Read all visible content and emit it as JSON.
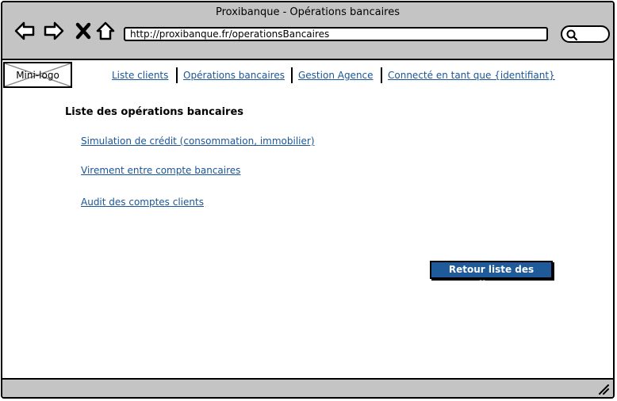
{
  "window": {
    "title": "Proxibanque - Opérations bancaires",
    "url": "http://proxibanque.fr/operationsBancaires"
  },
  "icons": {
    "back": "arrow-left-icon",
    "forward": "arrow-right-icon",
    "stop": "close-icon",
    "home": "home-icon",
    "search": "search-icon",
    "resize": "resize-grip-icon"
  },
  "logo": {
    "label": "Mini-logo"
  },
  "nav": {
    "items": [
      {
        "label": "Liste clients"
      },
      {
        "label": "Opérations bancaires"
      },
      {
        "label": "Gestion Agence"
      },
      {
        "label": "Connecté en tant que {identifiant}"
      }
    ]
  },
  "main": {
    "heading": "Liste des opérations bancaires",
    "links": [
      {
        "label": "Simulation de crédit (consommation, immobilier)"
      },
      {
        "label": "Virement entre compte bancaires"
      },
      {
        "label": "Audit des comptes clients"
      }
    ],
    "back_button": "Retour liste des clients"
  },
  "colors": {
    "chrome": "#c4c4c4",
    "link": "#1a5597",
    "button": "#1f5a9a"
  }
}
